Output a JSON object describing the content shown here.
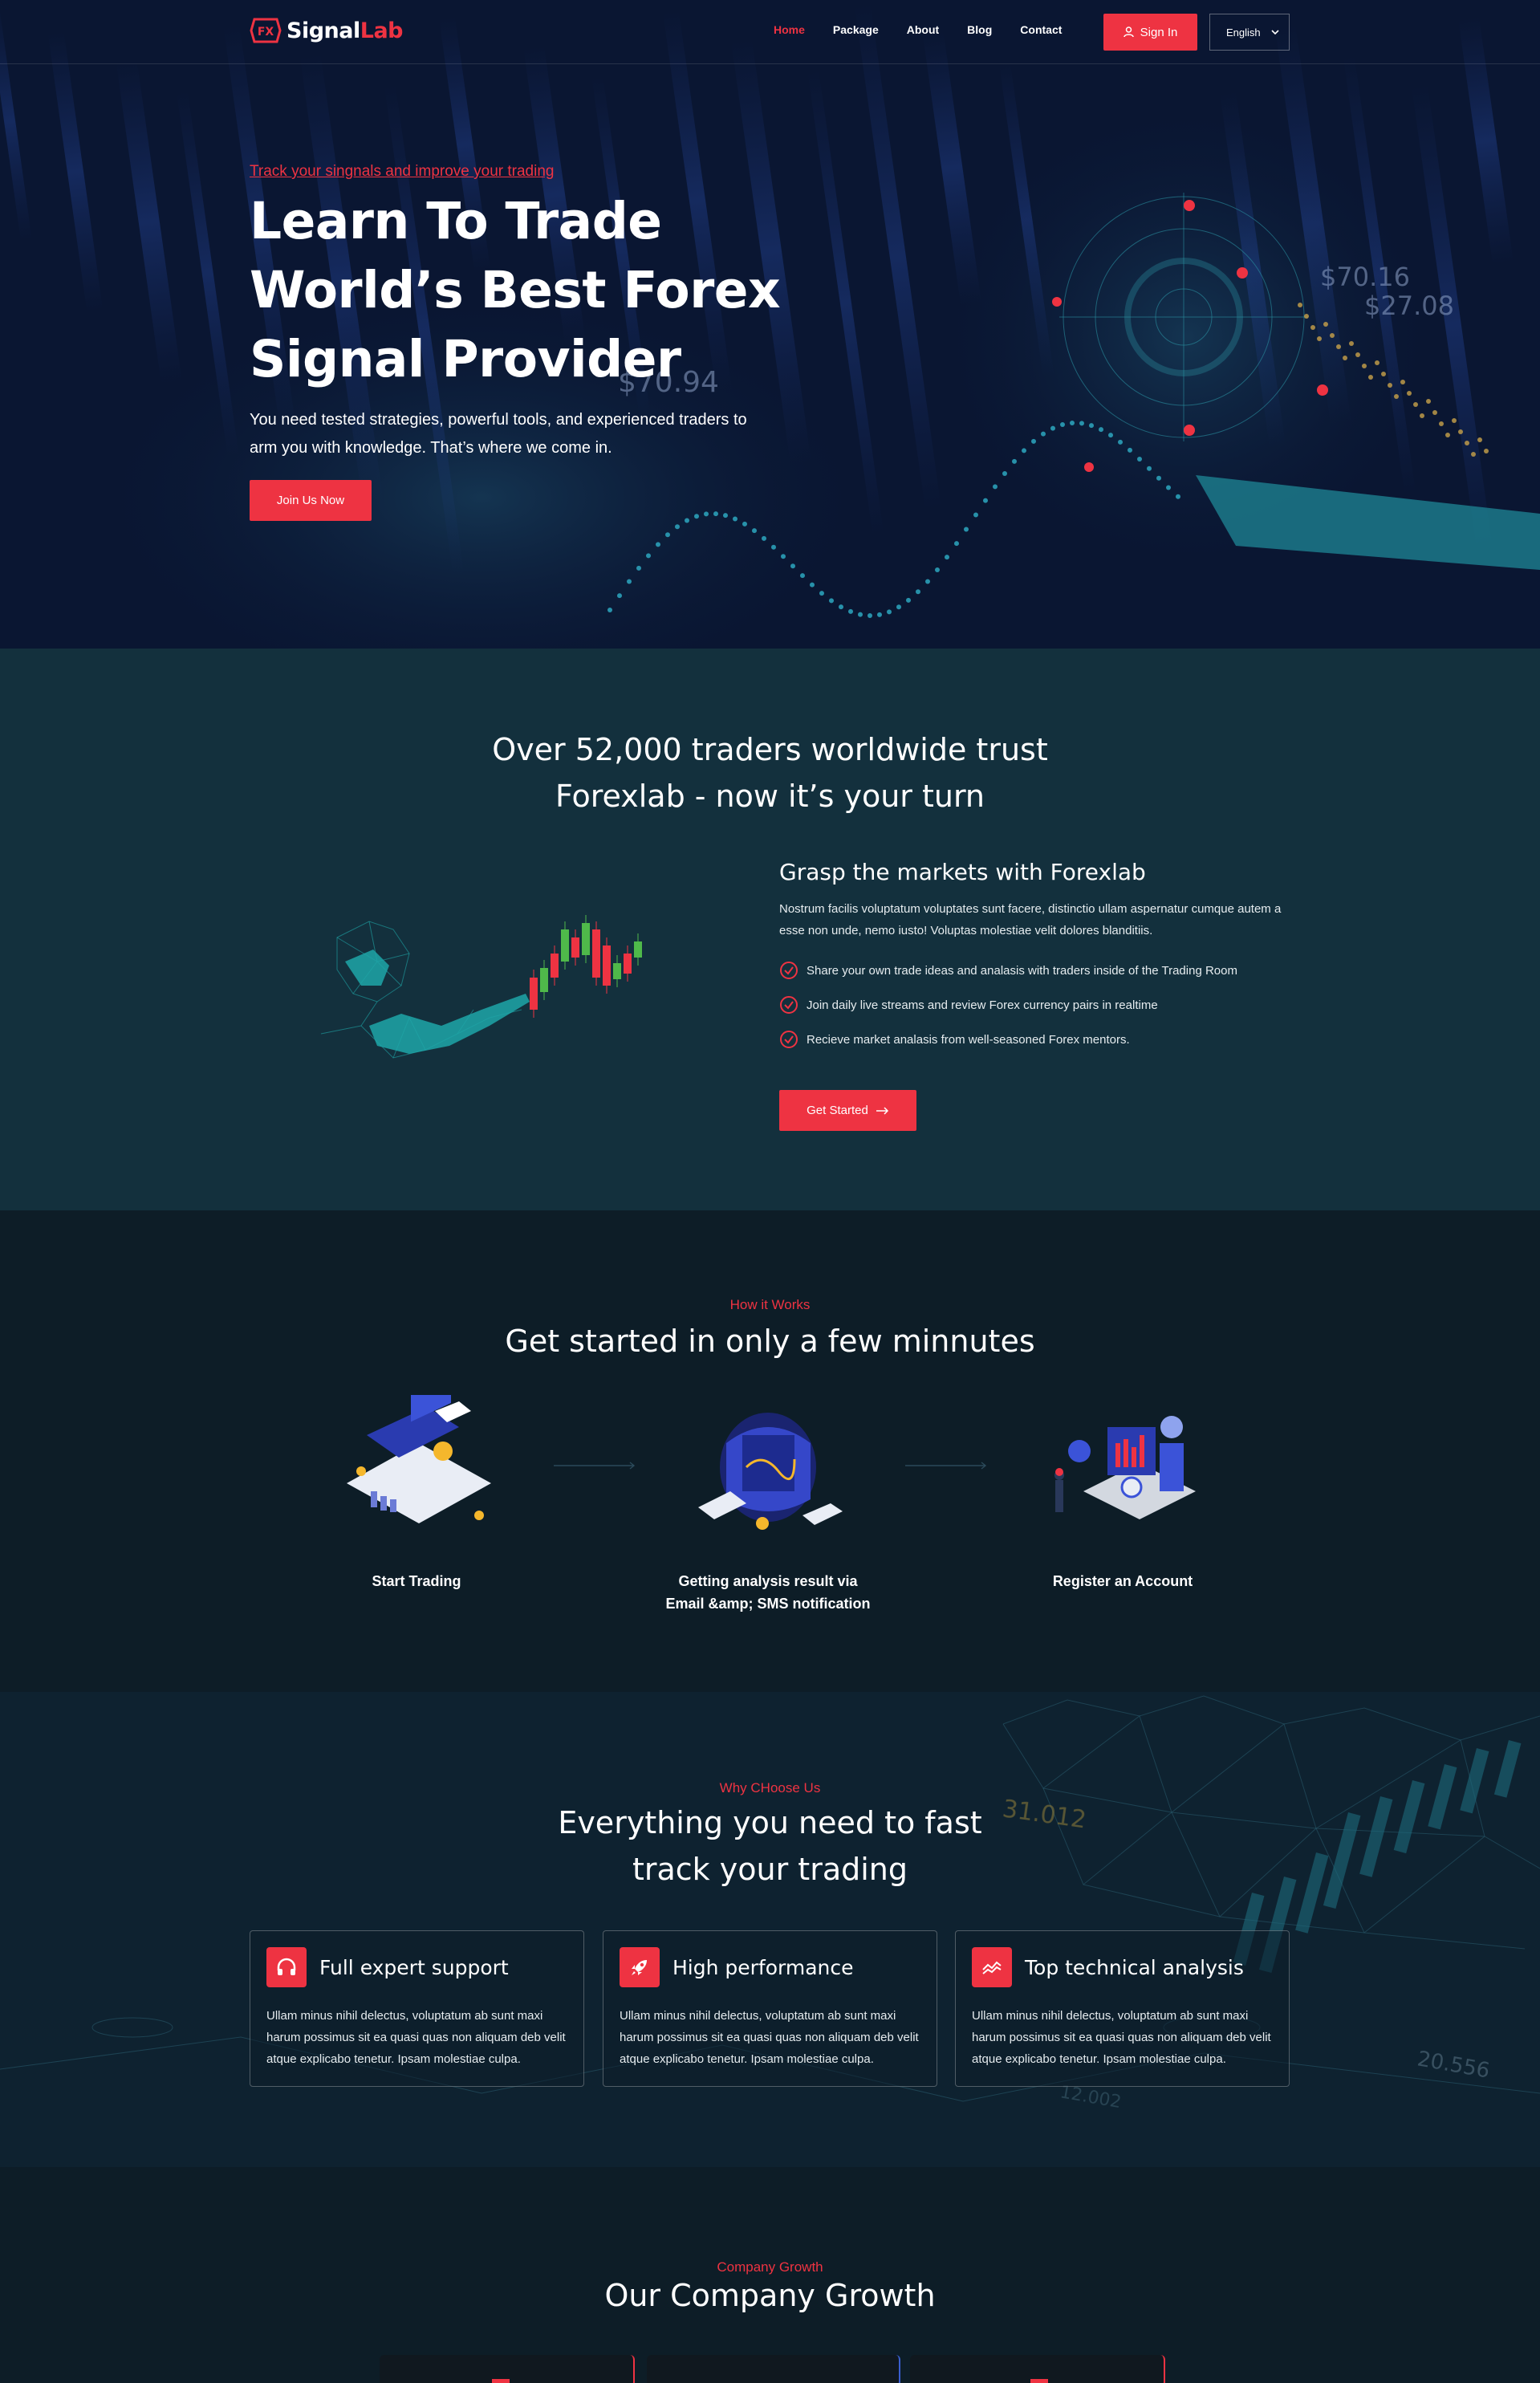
{
  "nav": {
    "logo": {
      "part1": "Signal",
      "part2": "Lab"
    },
    "menu": [
      {
        "label": "Home",
        "active": true
      },
      {
        "label": "Package"
      },
      {
        "label": "About"
      },
      {
        "label": "Blog"
      },
      {
        "label": "Contact"
      }
    ],
    "signin_label": "Sign In",
    "language": "English"
  },
  "hero": {
    "subtitle": "Track your singnals and improve your trading",
    "title_lines": [
      "Learn To Trade",
      "World’s Best Forex",
      "Signal Provider"
    ],
    "description": "You need tested strategies, powerful tools, and experienced traders to arm you with knowledge. That’s where we come in.",
    "button": "Join Us Now",
    "bg_numbers": [
      "$70.94",
      "$70.16",
      "$27.08"
    ]
  },
  "trust": {
    "title_line1": "Over 52,000 traders worldwide trust",
    "title_line2": "Forexlab - now it’s your turn",
    "grasp_title": "Grasp the markets with Forexlab",
    "grasp_text": "Nostrum facilis voluptatum voluptates sunt facere, distinctio ullam aspernatur cumque autem a esse non unde, nemo iusto! Voluptas molestiae velit dolores blanditiis.",
    "checklist": [
      "Share your own trade ideas and analasis with traders inside of the Trading Room",
      "Join daily live streams and review Forex currency pairs in realtime",
      "Recieve market analasis from well-seasoned Forex mentors."
    ],
    "button": "Get Started"
  },
  "how": {
    "kicker": "How it Works",
    "title": "Get started in only a few minnutes",
    "steps": [
      {
        "label": "Start Trading"
      },
      {
        "label_line1": "Getting analysis result via",
        "label_line2": "Email &amp; SMS notification"
      },
      {
        "label": "Register an Account"
      }
    ]
  },
  "why": {
    "kicker": "Why CHoose Us",
    "title_line1": "Everything you need to fast",
    "title_line2": "track your trading",
    "bg_numbers": [
      "31.012",
      "20.556",
      "12.002"
    ],
    "cards": [
      {
        "icon": "headphones-icon",
        "title": "Full expert support",
        "text": "Ullam minus nihil delectus, voluptatum ab sunt maxi harum possimus sit ea quasi quas non aliquam deb velit atque explicabo tenetur. Ipsam molestiae culpa."
      },
      {
        "icon": "rocket-icon",
        "title": "High performance",
        "text": "Ullam minus nihil delectus, voluptatum ab sunt maxi harum possimus sit ea quasi quas non aliquam deb velit atque explicabo tenetur. Ipsam molestiae culpa."
      },
      {
        "icon": "chart-icon",
        "title": "Top technical analysis",
        "text": "Ullam minus nihil delectus, voluptatum ab sunt maxi harum possimus sit ea quasi quas non aliquam deb velit atque explicabo tenetur. Ipsam molestiae culpa."
      }
    ]
  },
  "growth": {
    "kicker": "Company Growth",
    "title": "Our Company Growth"
  },
  "colors": {
    "accent": "#ee3342",
    "bg_dark": "#0d1d27",
    "bg_teal": "#13303d",
    "teal": "#1fa6a8"
  }
}
